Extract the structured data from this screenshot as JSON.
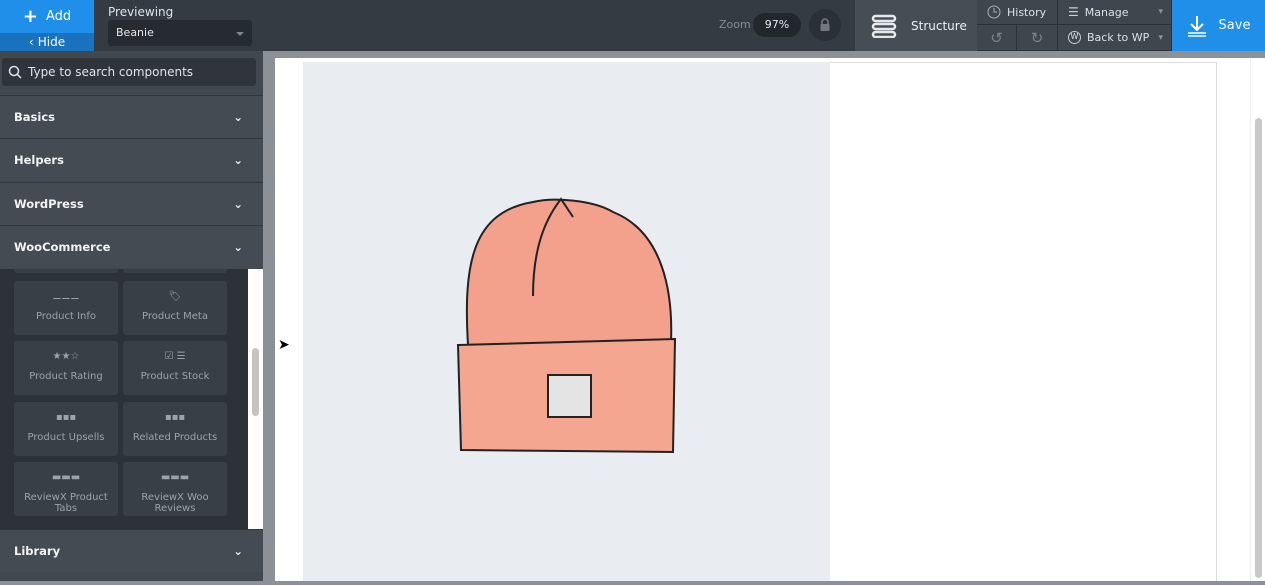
{
  "toolbar": {
    "add_label": "Add",
    "hide_label": "Hide",
    "previewing_label": "Previewing",
    "previewing_value": "Beanie",
    "zoom_label": "Zoom",
    "zoom_value": "97%",
    "structure_label": "Structure",
    "history_label": "History",
    "manage_label": "Manage",
    "back_label": "Back to WP",
    "save_label": "Save"
  },
  "sidebar": {
    "search_placeholder": "Type to search components",
    "categories": [
      {
        "label": "Basics"
      },
      {
        "label": "Helpers"
      },
      {
        "label": "WordPress"
      },
      {
        "label": "WooCommerce"
      },
      {
        "label": "Library"
      }
    ],
    "components": [
      {
        "label": "Product Info",
        "icon": "info-lines-icon"
      },
      {
        "label": "Product Meta",
        "icon": "tag-cart-icon"
      },
      {
        "label": "Product Rating",
        "icon": "stars-icon"
      },
      {
        "label": "Product Stock",
        "icon": "checkbox-lines-icon"
      },
      {
        "label": "Product Upsells",
        "icon": "cart-grid-icon"
      },
      {
        "label": "Related Products",
        "icon": "cart-grid-icon"
      },
      {
        "label": "ReviewX Product Tabs",
        "icon": "tabs-icon"
      },
      {
        "label": "ReviewX Woo Reviews",
        "icon": "tabs-icon"
      }
    ]
  },
  "colors": {
    "accent": "#1f8fe9",
    "sidebar": "#414850",
    "topbar": "#353b42",
    "beanie": "#f3a08c"
  }
}
